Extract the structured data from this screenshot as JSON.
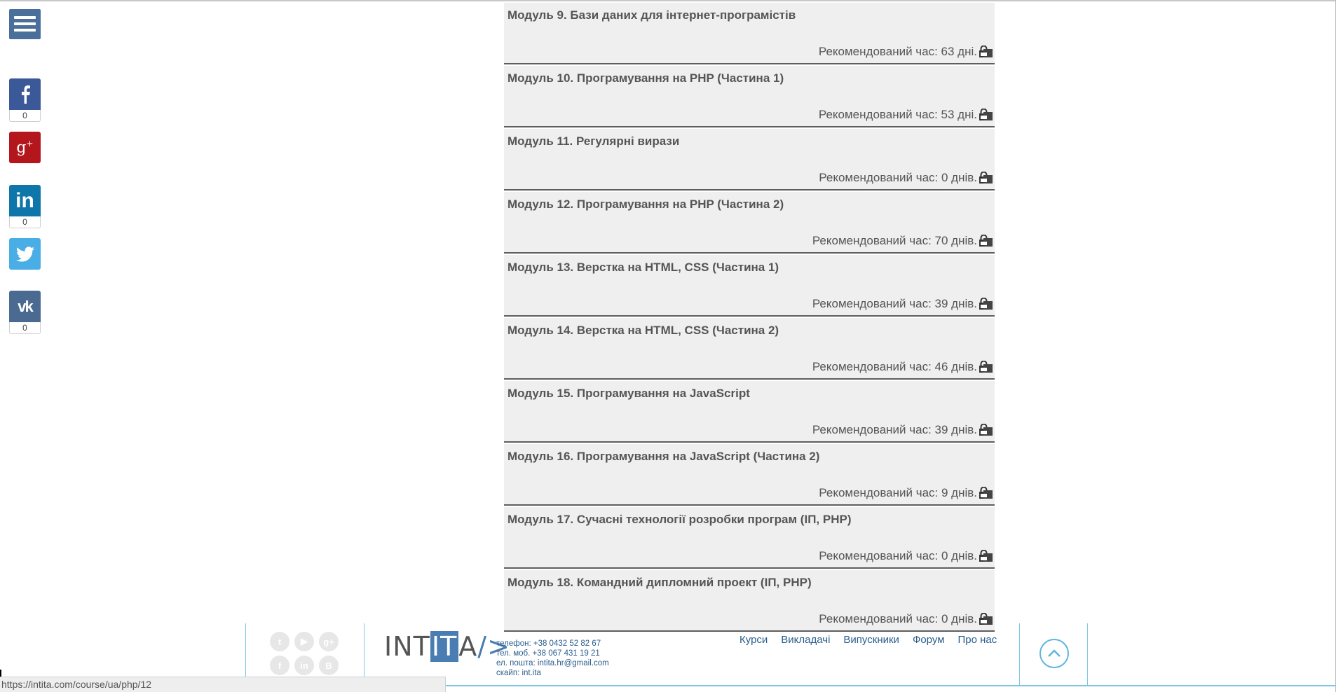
{
  "sidebar": {
    "share_counts": {
      "facebook": "0",
      "linkedin": "0",
      "vk": "0"
    },
    "colors": {
      "menu": "#4a6f9a",
      "facebook": "#3b5998",
      "google": "#b3171d",
      "linkedin": "#0e76a8",
      "twitter": "#4aaee6",
      "vk": "#4a6a92"
    }
  },
  "modules": [
    {
      "title": "Модуль 9. Бази даних для інтернет-програмістів",
      "time": "Рекомендований час: 63 дні."
    },
    {
      "title": "Модуль 10. Програмування на PHP (Частина 1)",
      "time": "Рекомендований час: 53 дні."
    },
    {
      "title": "Модуль 11. Регулярні вирази",
      "time": "Рекомендований час: 0 днів."
    },
    {
      "title": "Модуль 12. Програмування на PHP (Частина 2)",
      "time": "Рекомендований час: 70 днів."
    },
    {
      "title": "Модуль 13. Верстка на HTML, CSS (Частина 1)",
      "time": "Рекомендований час: 39 днів."
    },
    {
      "title": "Модуль 14. Верстка на HTML, CSS (Частина 2)",
      "time": "Рекомендований час: 46 днів."
    },
    {
      "title": "Модуль 15. Програмування на JavaScript",
      "time": "Рекомендований час: 39 днів."
    },
    {
      "title": "Модуль 16. Програмування на JavaScript (Частина 2)",
      "time": "Рекомендований час: 9 днів."
    },
    {
      "title": "Модуль 17. Сучасні технології розробки програм (ІП, PHP)",
      "time": "Рекомендований час: 0 днів."
    },
    {
      "title": "Модуль 18. Командний дипломний проект (ІП, PHP)",
      "time": "Рекомендований час: 0 днів."
    }
  ],
  "footer": {
    "logo": {
      "left": "INT",
      "mid": "IT",
      "right": "A",
      "slash": "/>"
    },
    "contacts": {
      "phone": "телефон: +38 0432 52 82 67",
      "mobile": "тел. моб. +38 067 431 19 21",
      "email": "ел. пошта: intita.hr@gmail.com",
      "skype": "скайп: int.ita"
    },
    "nav": [
      "Курси",
      "Викладачі",
      "Випускники",
      "Форум",
      "Про нас"
    ],
    "social_icons": [
      "twitter-icon",
      "youtube-icon",
      "google-plus-icon",
      "facebook-icon",
      "linkedin-icon",
      "vk-icon"
    ]
  },
  "status_bar": {
    "url": "https://intita.com/course/ua/php/12"
  }
}
